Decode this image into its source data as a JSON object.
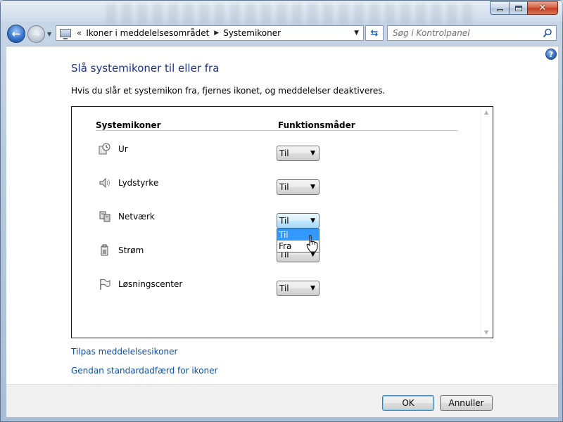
{
  "window": {
    "controls": {
      "minimize": "minimize",
      "maximize": "maximize",
      "close": "✕"
    }
  },
  "nav": {
    "back_icon": "back-arrow-icon",
    "forward_icon": "forward-arrow-icon",
    "address": {
      "overflow": "«",
      "crumbs": [
        "Ikoner i meddelelsesområdet",
        "Systemikoner"
      ]
    },
    "search": {
      "placeholder": "Søg i Kontrolpanel"
    }
  },
  "content": {
    "title": "Slå systemikoner til eller fra",
    "description": "Hvis du slår et systemikon fra, fjernes ikonet, og meddelelser deaktiveres.",
    "columns": {
      "icons": "Systemikoner",
      "modes": "Funktionsmåder"
    },
    "rows": [
      {
        "label": "Ur",
        "value": "Til",
        "icon": "clock-icon"
      },
      {
        "label": "Lydstyrke",
        "value": "Til",
        "icon": "speaker-icon"
      },
      {
        "label": "Netværk",
        "value": "Til",
        "icon": "network-icon"
      },
      {
        "label": "Strøm",
        "value": "Til",
        "icon": "power-icon"
      },
      {
        "label": "Løsningscenter",
        "value": "Til",
        "icon": "flag-icon"
      }
    ],
    "open_dropdown": {
      "row": "Netværk",
      "options": [
        "Til",
        "Fra"
      ],
      "highlighted": "Til"
    },
    "links": {
      "customize": "Tilpas meddelelsesikoner",
      "restore": "Gendan standardadfærd for ikoner"
    }
  },
  "footer": {
    "ok": "OK",
    "cancel": "Annuller"
  },
  "colors": {
    "title": "#1e3287",
    "link": "#0b4ea5",
    "selection": "#3399ff"
  }
}
